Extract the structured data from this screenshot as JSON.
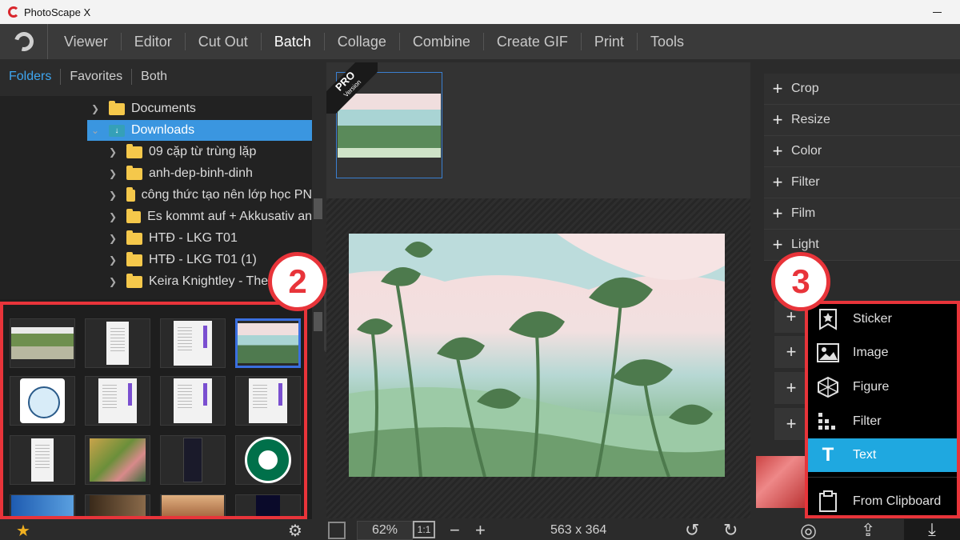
{
  "window": {
    "title": "PhotoScape X"
  },
  "menu": {
    "items": [
      "Viewer",
      "Editor",
      "Cut Out",
      "Batch",
      "Collage",
      "Combine",
      "Create GIF",
      "Print",
      "Tools"
    ],
    "active": "Batch"
  },
  "browser": {
    "tabs": [
      "Folders",
      "Favorites",
      "Both"
    ],
    "active_tab": "Folders",
    "tree": [
      {
        "label": "Documents",
        "indent": 0,
        "type": "folder"
      },
      {
        "label": "Downloads",
        "indent": 0,
        "type": "downloads",
        "selected": true
      },
      {
        "label": "09 cặp từ trùng lặp",
        "indent": 1,
        "type": "folder"
      },
      {
        "label": "anh-dep-binh-dinh",
        "indent": 1,
        "type": "folder"
      },
      {
        "label": "công thức tạo nên lớp học PN",
        "indent": 1,
        "type": "folder"
      },
      {
        "label": "Es kommt auf + Akkusativ an",
        "indent": 1,
        "type": "folder"
      },
      {
        "label": "HTĐ - LKG T01",
        "indent": 1,
        "type": "folder"
      },
      {
        "label": "HTĐ - LKG T01 (1)",
        "indent": 1,
        "type": "folder"
      },
      {
        "label": "Keira Knightley - The",
        "indent": 1,
        "type": "folder"
      }
    ]
  },
  "annotations": {
    "badge_left": "2",
    "badge_right": "3"
  },
  "pro_badge": {
    "line1": "PRO",
    "line2": "Version"
  },
  "tools": [
    "Crop",
    "Resize",
    "Color",
    "Filter",
    "Film",
    "Light"
  ],
  "object_menu": {
    "items": [
      {
        "label": "Sticker",
        "icon": "sticker-icon"
      },
      {
        "label": "Image",
        "icon": "image-icon"
      },
      {
        "label": "Figure",
        "icon": "figure-icon"
      },
      {
        "label": "Filter",
        "icon": "filter-icon"
      },
      {
        "label": "Text",
        "icon": "text-icon",
        "active": true
      },
      {
        "label": "From Clipboard",
        "icon": "clipboard-icon"
      }
    ]
  },
  "status": {
    "zoom": "62%",
    "actual_size": "1:1",
    "dimensions": "563 x 364"
  },
  "colors": {
    "accent": "#3ea6f0",
    "selection": "#3a96e0",
    "highlight": "#1fa8e0",
    "annotation": "#e8343a"
  }
}
